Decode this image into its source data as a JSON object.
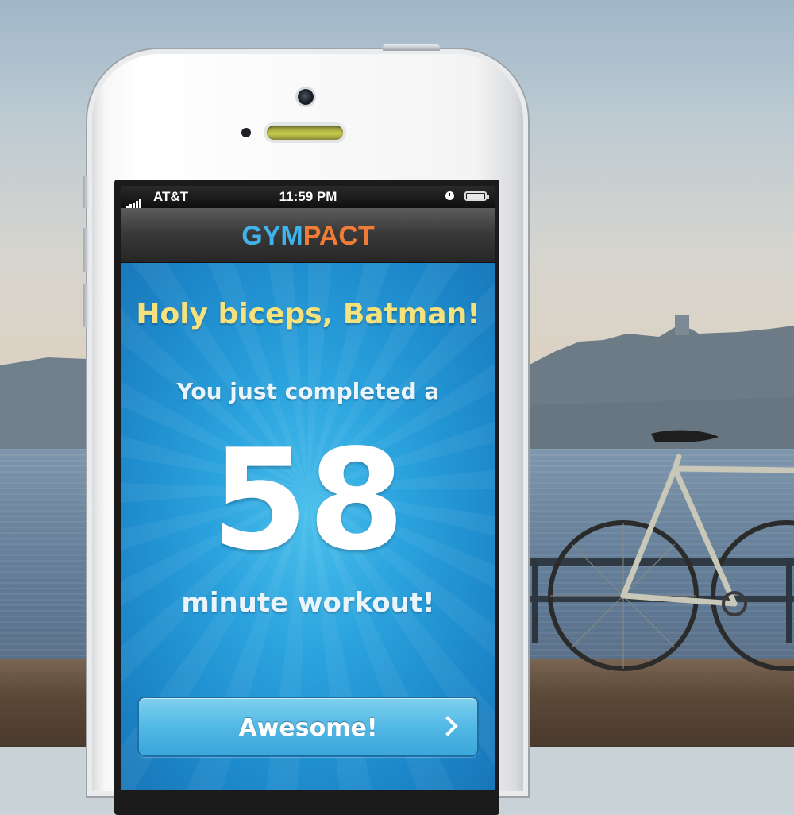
{
  "status_bar": {
    "carrier": "AT&T",
    "time": "11:59 PM",
    "signal_bars": 5,
    "alarm_icon": "alarm-clock-icon",
    "battery_icon": "battery-icon",
    "battery_level": 0.95
  },
  "nav": {
    "logo_left": "GYM",
    "logo_right": "PACT",
    "logo_plus": "+"
  },
  "workout": {
    "headline": "Holy biceps, Batman!",
    "intro": "You just completed a",
    "minutes": "58",
    "unit_text": "minute workout!"
  },
  "actions": {
    "awesome_label": "Awesome!",
    "awesome_icon": "chevron-right-icon"
  },
  "colors": {
    "logo_blue": "#3fb4ea",
    "logo_orange": "#f07c35",
    "headline_yellow": "#f5e27d",
    "screen_blue": "#2ba3de"
  }
}
